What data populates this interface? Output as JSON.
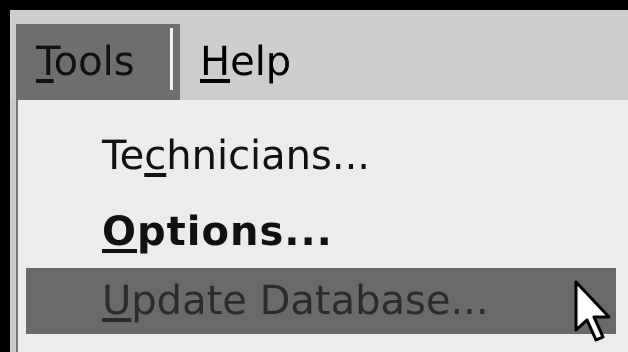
{
  "menubar": {
    "tools": {
      "underlined": "T",
      "rest": "ools"
    },
    "help": {
      "underlined": "H",
      "rest": "elp"
    }
  },
  "tools_menu": {
    "items": [
      {
        "pre": "Te",
        "underlined": "c",
        "post": "hnicians..."
      },
      {
        "pre": "",
        "underlined": "O",
        "post": "ptions..."
      },
      {
        "pre": "",
        "underlined": "U",
        "post": "pdate Database..."
      }
    ],
    "default_item_index": 1,
    "highlighted_item_index": 2
  },
  "cursor": {
    "icon": "arrow-pointer-icon"
  },
  "colors": {
    "menu_highlight": "#6a6a6a",
    "menubar_active": "#6e6e6e",
    "menu_background": "#ececec"
  }
}
